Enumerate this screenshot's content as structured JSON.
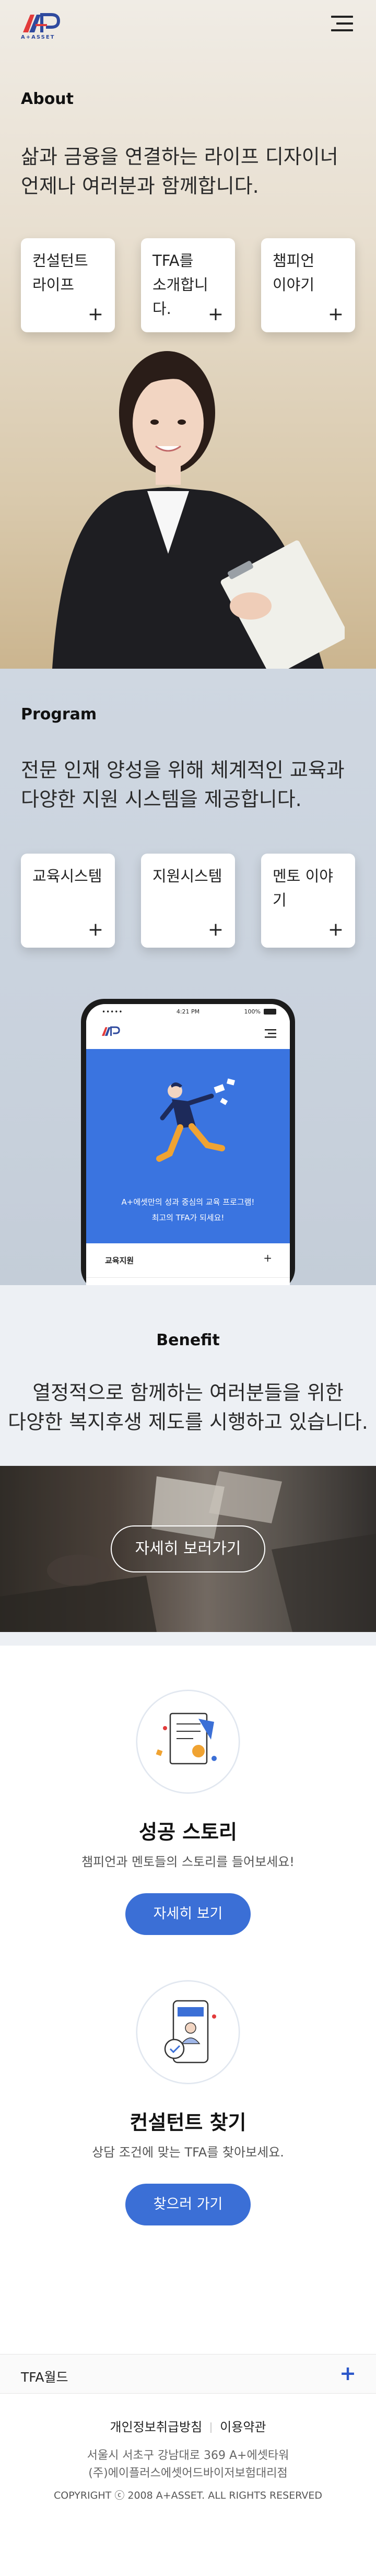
{
  "header": {
    "logo_sub": "A+ASSET",
    "menu_icon": "hamburger-menu-icon"
  },
  "about": {
    "label": "About",
    "lead_line1": "삶과 금융을 연결하는 라이프 디자이너",
    "lead_line2": "언제나 여러분과 함께합니다.",
    "cards": [
      {
        "line1": "컨설턴트",
        "line2": "라이프"
      },
      {
        "line1": "TFA를",
        "line2": "소개합니다."
      },
      {
        "line1": "챔피언",
        "line2": "이야기"
      }
    ]
  },
  "program": {
    "label": "Program",
    "lead_line1": "전문 인재 양성을 위해 체계적인 교육과",
    "lead_line2": "다양한 지원 시스템을 제공합니다.",
    "cards": [
      {
        "label": "교육시스템"
      },
      {
        "label": "지원시스템"
      },
      {
        "label": "멘토 이야기"
      }
    ],
    "phone": {
      "time": "4:21 PM",
      "battery": "100%",
      "hero_line1": "A+에셋만의 성과 중심의 교육 프로그램!",
      "hero_line2": "최고의 TFA가 되세요!",
      "menu_label": "교육지원"
    }
  },
  "benefit": {
    "title": "Benefit",
    "lead_line1": "열정적으로 함께하는 여러분들을 위한",
    "lead_line2": "다양한 복지후생 제도를 시행하고 있습니다.",
    "button": "자세히 보러가기"
  },
  "stories": [
    {
      "title": "성공 스토리",
      "sub": "챔피언과 멘토들의 스토리를 들어보세요!",
      "button": "자세히 보기"
    },
    {
      "title": "컨설턴트 찾기",
      "sub": "상담 조건에 맞는 TFA를 찾아보세요.",
      "button": "찾으러 가기"
    }
  ],
  "footer": {
    "tfa_label": "TFA월드",
    "link_privacy": "개인정보취급방침",
    "link_terms": "이용약관",
    "addr1": "서울시 서초구 강남대로 369 A+에셋타워",
    "addr2": "(주)에이플러스에셋어드바이저보험대리점",
    "copyright": "COPYRIGHT ⓒ 2008 A+ASSET. ALL RIGHTS RESERVED"
  },
  "colors": {
    "accent": "#3b6fd6",
    "brand_navy": "#2f4a9e",
    "brand_red": "#e23b3b",
    "phone_hero": "#3a74e0"
  }
}
